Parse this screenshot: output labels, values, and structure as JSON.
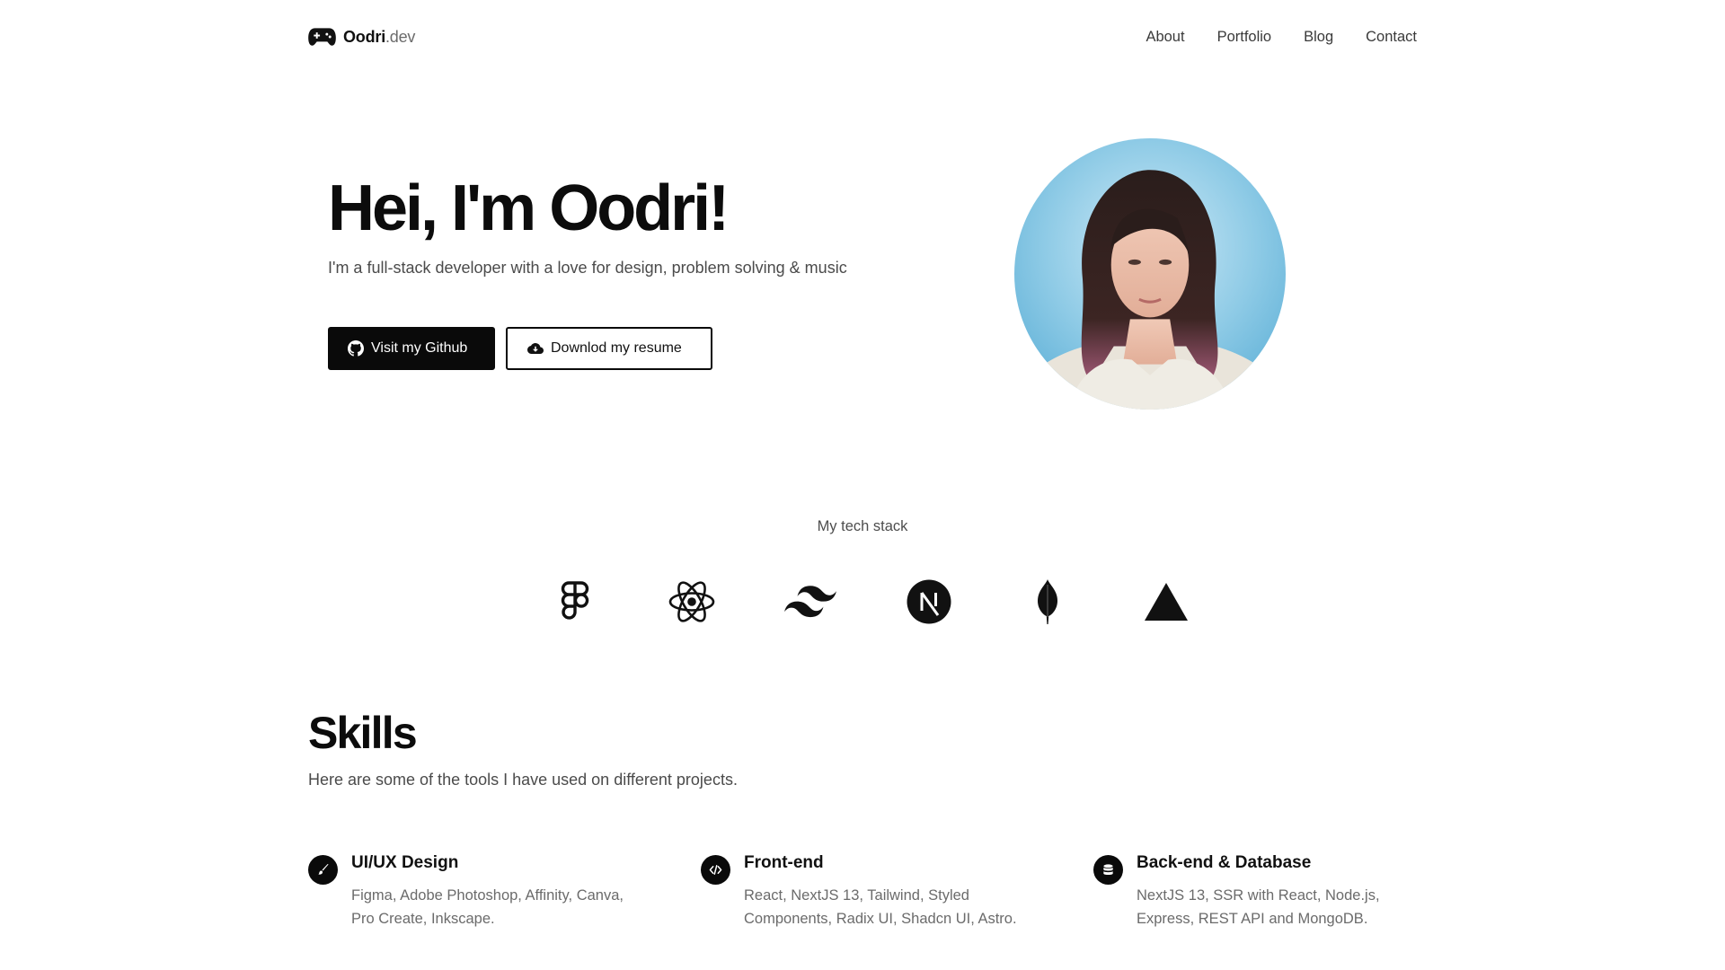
{
  "brand": {
    "name_bold": "Oodri",
    "name_light": ".dev",
    "icon": "gamepad-icon"
  },
  "nav": {
    "links": [
      "About",
      "Portfolio",
      "Blog",
      "Contact"
    ]
  },
  "hero": {
    "title": "Hei, I'm Oodri!",
    "subtitle": "I'm a full-stack developer with a love for design, problem solving & music",
    "github_button": {
      "label": "Visit my Github",
      "icon": "github-icon"
    },
    "resume_button": {
      "label": "Downlod my resume",
      "icon": "cloud-download-icon"
    }
  },
  "tech_stack": {
    "title": "My tech stack",
    "icons": [
      "figma-icon",
      "react-icon",
      "tailwind-icon",
      "nextjs-icon",
      "mongodb-icon",
      "vercel-icon"
    ]
  },
  "skills": {
    "title": "Skills",
    "subtitle": "Here are some of the tools I have used on different projects.",
    "items": [
      {
        "title": "UI/UX Design",
        "description": "Figma, Adobe Photoshop, Affinity, Canva, Pro Create, Inkscape.",
        "icon": "brush-icon"
      },
      {
        "title": "Front-end",
        "description": "React, NextJS 13, Tailwind, Styled Components, Radix UI, Shadcn UI, Astro.",
        "icon": "code-icon"
      },
      {
        "title": "Back-end & Database",
        "description": "NextJS 13, SSR with React, Node.js, Express, REST API and MongoDB.",
        "icon": "database-icon"
      }
    ]
  },
  "colors": {
    "primary": "#0a0a0a",
    "text_muted": "#6b6b6b",
    "background": "#ffffff"
  }
}
